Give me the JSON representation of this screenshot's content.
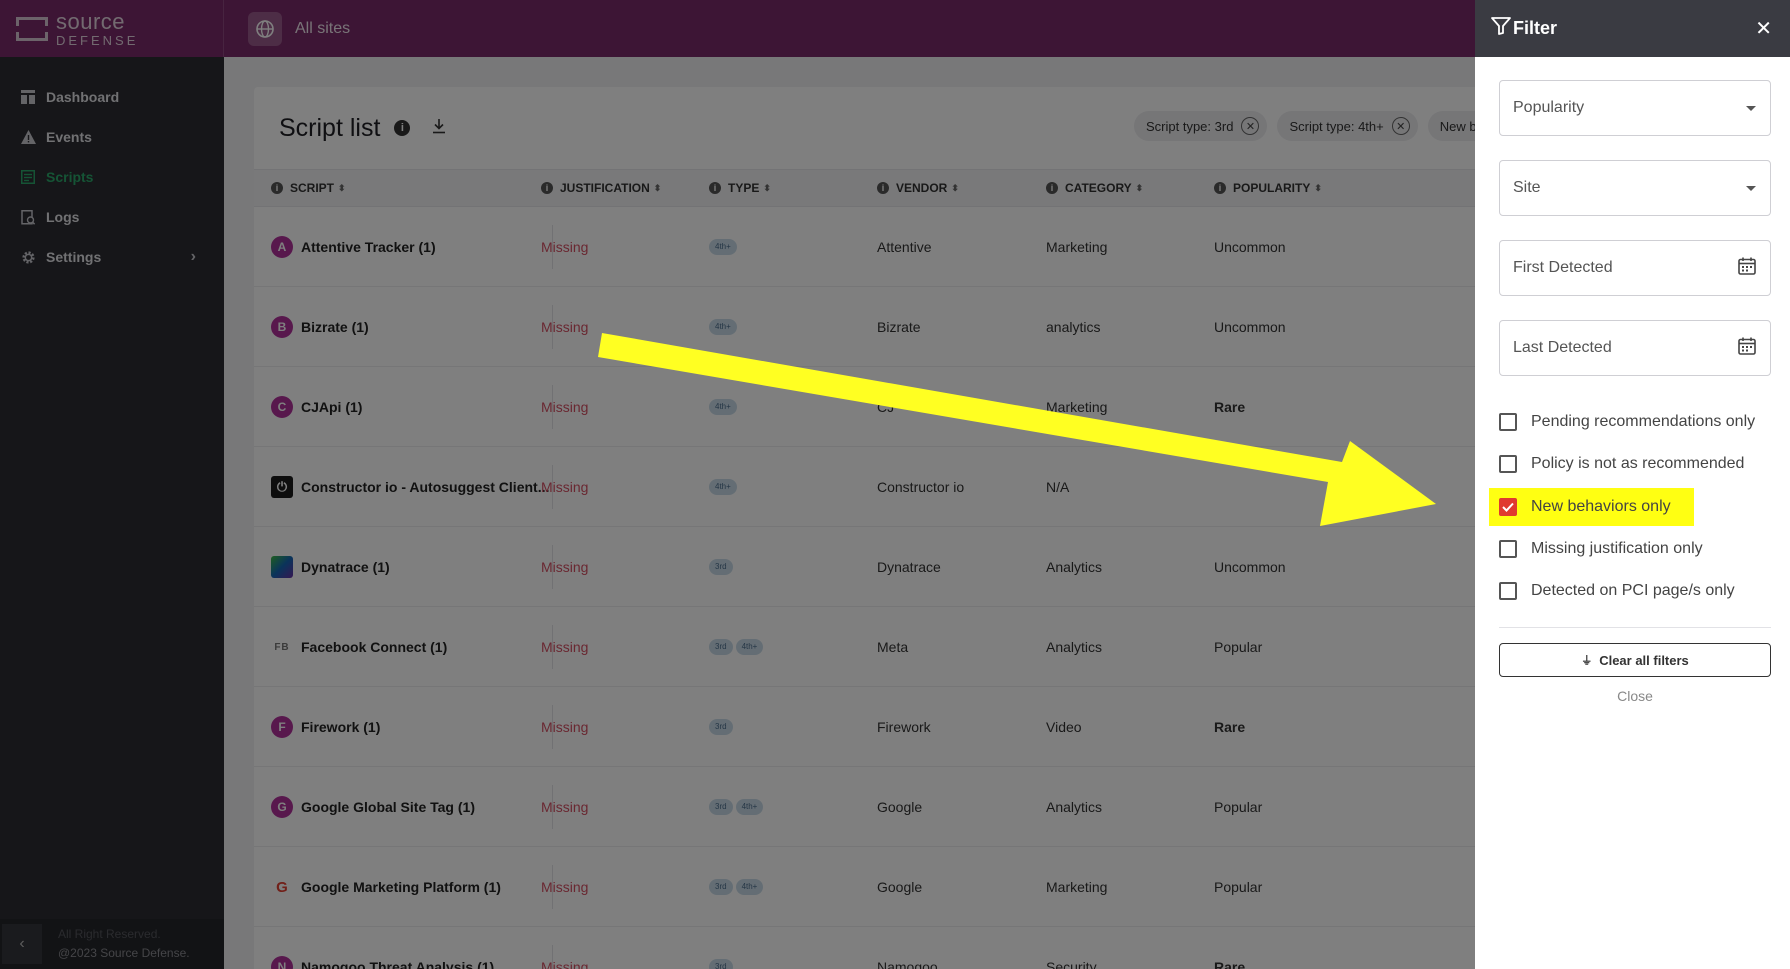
{
  "brand": {
    "line1": "source",
    "line2": "DEFENSE"
  },
  "topbar": {
    "sites_label": "All sites"
  },
  "sidebar": {
    "items": [
      {
        "label": "Dashboard",
        "icon": "dashboard-icon"
      },
      {
        "label": "Events",
        "icon": "warning-icon"
      },
      {
        "label": "Scripts",
        "icon": "scripts-icon",
        "active": true
      },
      {
        "label": "Logs",
        "icon": "logs-icon"
      },
      {
        "label": "Settings",
        "icon": "gear-icon"
      }
    ],
    "footer_line1": "All Right Reserved.",
    "footer_line2": "@2023 Source Defense."
  },
  "main": {
    "title": "Script list",
    "chips": [
      "Script type: 3rd",
      "Script type: 4th+",
      "New behaviors only"
    ],
    "columns": [
      "SCRIPT",
      "JUSTIFICATION",
      "TYPE",
      "VENDOR",
      "CATEGORY",
      "POPULARITY"
    ],
    "rows": [
      {
        "avatar": "A",
        "name": "Attentive Tracker (1)",
        "justification": "Missing",
        "types": [
          "4th+"
        ],
        "vendor": "Attentive",
        "category": "Marketing",
        "popularity": "Uncommon"
      },
      {
        "avatar": "B",
        "name": "Bizrate (1)",
        "justification": "Missing",
        "types": [
          "4th+"
        ],
        "vendor": "Bizrate",
        "category": "analytics",
        "popularity": "Uncommon"
      },
      {
        "avatar": "C",
        "name": "CJApi (1)",
        "justification": "Missing",
        "types": [
          "4th+"
        ],
        "vendor": "CJ",
        "category": "Marketing",
        "popularity": "Rare"
      },
      {
        "avatar": "⏻",
        "name": "Constructor io - Autosuggest Client...",
        "justification": "Missing",
        "types": [
          "4th+"
        ],
        "vendor": "Constructor io",
        "category": "N/A",
        "popularity": ""
      },
      {
        "avatar": "",
        "name": "Dynatrace (1)",
        "justification": "Missing",
        "types": [
          "3rd"
        ],
        "vendor": "Dynatrace",
        "category": "Analytics",
        "popularity": "Uncommon"
      },
      {
        "avatar": "FB",
        "name": "Facebook Connect (1)",
        "justification": "Missing",
        "types": [
          "3rd",
          "4th+"
        ],
        "vendor": "Meta",
        "category": "Analytics",
        "popularity": "Popular"
      },
      {
        "avatar": "F",
        "name": "Firework (1)",
        "justification": "Missing",
        "types": [
          "3rd"
        ],
        "vendor": "Firework",
        "category": "Video",
        "popularity": "Rare"
      },
      {
        "avatar": "G",
        "name": "Google Global Site Tag (1)",
        "justification": "Missing",
        "types": [
          "3rd",
          "4th+"
        ],
        "vendor": "Google",
        "category": "Analytics",
        "popularity": "Popular"
      },
      {
        "avatar": "G",
        "name": "Google Marketing Platform (1)",
        "justification": "Missing",
        "types": [
          "3rd",
          "4th+"
        ],
        "vendor": "Google",
        "category": "Marketing",
        "popularity": "Popular"
      },
      {
        "avatar": "N",
        "name": "Namogoo Threat Analysis (1)",
        "justification": "Missing",
        "types": [
          "3rd"
        ],
        "vendor": "Namogoo",
        "category": "Security",
        "popularity": "Rare"
      }
    ]
  },
  "filter": {
    "title": "Filter",
    "popularity_placeholder": "Popularity",
    "site_placeholder": "Site",
    "first_detected_placeholder": "First Detected",
    "last_detected_placeholder": "Last Detected",
    "checkboxes": [
      {
        "label": "Pending recommendations only",
        "checked": false
      },
      {
        "label": "Policy is not as recommended",
        "checked": false
      },
      {
        "label": "New behaviors only",
        "checked": true
      },
      {
        "label": "Missing justification only",
        "checked": false
      },
      {
        "label": "Detected on PCI page/s only",
        "checked": false
      }
    ],
    "clear_label": "Clear all filters",
    "close_label": "Close"
  },
  "colors": {
    "brand": "#7b2a6a",
    "sidebar": "#2c2d33",
    "active_nav": "#2aa86a",
    "missing": "#d44f63",
    "checkbox_checked": "#e03a2f",
    "highlight": "#ffff12"
  }
}
